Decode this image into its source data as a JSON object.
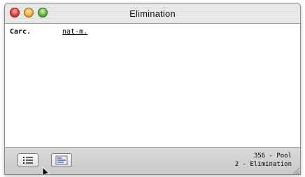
{
  "window": {
    "title": "Elimination"
  },
  "record": {
    "label": "Carc.",
    "value": "nat-m."
  },
  "status": {
    "line1": "356 - Pool",
    "line2": "2 - Elimination"
  },
  "icons": {
    "close": "close-button",
    "minimize": "minimize-button",
    "zoom": "zoom-button",
    "list": "list-view-icon",
    "columns": "column-view-icon",
    "cursor": "mouse-pointer-icon",
    "resize": "resize-grip-icon"
  },
  "colors": {
    "close": "#e0413a",
    "minimize": "#f2b13a",
    "zoom": "#5fb83c",
    "list_accent": "#3d5bd1"
  }
}
